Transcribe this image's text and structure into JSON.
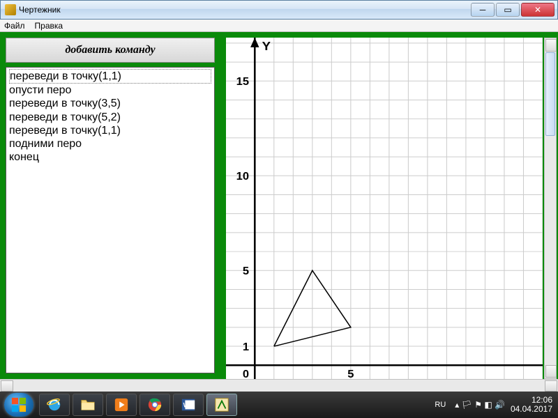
{
  "window": {
    "title": "Чертежник"
  },
  "menu": {
    "file": "Файл",
    "edit": "Правка"
  },
  "panel": {
    "add_button": "добавить команду",
    "commands": [
      "переведи в точку(1,1)",
      "опусти перо",
      "переведи в точку(3,5)",
      "переведи в точку(5,2)",
      "переведи в точку(1,1)",
      "подними перо",
      "конец"
    ],
    "selected_index": 0
  },
  "chart_data": {
    "type": "line",
    "title": "",
    "xlabel": "",
    "ylabel": "Y",
    "xlim": [
      0,
      15
    ],
    "ylim": [
      0,
      17
    ],
    "x_ticks": [
      5
    ],
    "y_ticks": [
      1,
      5,
      10,
      15
    ],
    "series": [
      {
        "name": "triangle",
        "points": [
          [
            1,
            1
          ],
          [
            3,
            5
          ],
          [
            5,
            2
          ],
          [
            1,
            1
          ]
        ]
      }
    ],
    "grid": true
  },
  "taskbar": {
    "lang": "RU",
    "time": "12:06",
    "date": "04.04.2017"
  }
}
